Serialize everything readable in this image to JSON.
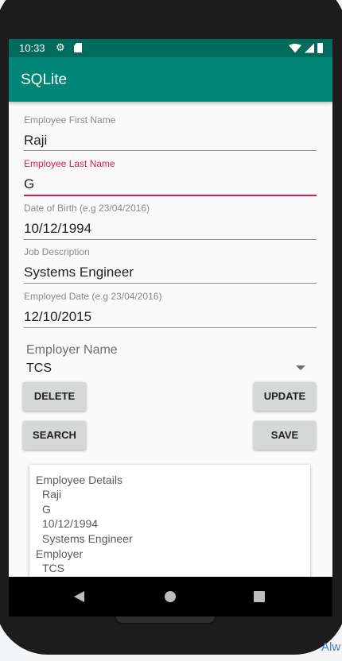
{
  "status_bar": {
    "time": "10:33",
    "gear_icon": "gear-icon",
    "sd_icon": "sd-card-icon",
    "wifi_icon": "wifi-icon",
    "cell_icon": "cell-signal-icon",
    "battery_icon": "battery-icon"
  },
  "app_bar": {
    "title": "SQLite"
  },
  "form": {
    "first_name": {
      "label": "Employee First Name",
      "value": "Raji"
    },
    "last_name": {
      "label": "Employee Last Name",
      "value": "G"
    },
    "dob": {
      "label": "Date of Birth (e.g 23/04/2016)",
      "value": "10/12/1994"
    },
    "job": {
      "label": "Job Description",
      "value": "Systems Engineer"
    },
    "employed": {
      "label": "Employed Date (e.g 23/04/2016)",
      "value": "12/10/2015"
    },
    "employer": {
      "label": "Employer Name",
      "selected": "TCS"
    }
  },
  "buttons": {
    "delete": "DELETE",
    "update": "UPDATE",
    "search": "SEARCH",
    "save": "SAVE"
  },
  "details": {
    "heading": "Employee Details",
    "lines": [
      "Raji",
      "G",
      "10/12/1994",
      "Systems Engineer"
    ],
    "employer_heading": "Employer",
    "employer_value": "TCS"
  },
  "nav": {
    "back_icon": "back-icon",
    "home_icon": "home-icon",
    "recents_icon": "recents-icon"
  },
  "corner_text": "Alw",
  "colors": {
    "status_bar": "#016b5e",
    "app_bar": "#008577",
    "accent": "#d81b60",
    "button": "#d6d7d7"
  }
}
